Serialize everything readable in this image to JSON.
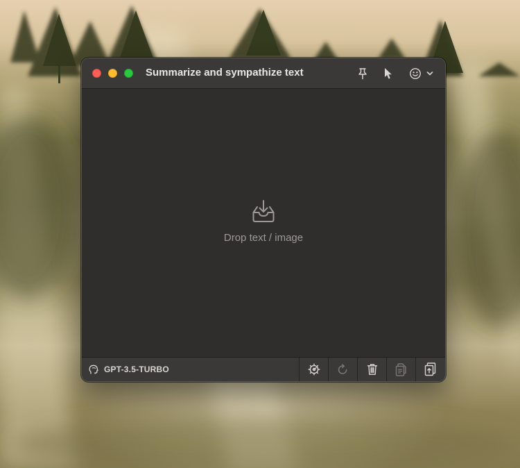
{
  "window": {
    "title": "Summarize and sympathize text"
  },
  "titlebar_icons": [
    "pin-icon",
    "cursor-icon",
    "smiley-icon",
    "chevron-down-icon"
  ],
  "content": {
    "drop_icon": "tray-download-icon",
    "drop_label": "Drop text / image"
  },
  "footer": {
    "model_icon": "head-icon",
    "model_label": "GPT-3.5-TURBO",
    "buttons": [
      "settings-gear-icon",
      "refresh-icon",
      "trash-icon",
      "copy-icon",
      "share-icon"
    ]
  },
  "colors": {
    "window_bg": "#2f2e2c",
    "titlebar_bg": "#3a3937",
    "close": "#ff5f57",
    "minimize": "#febc2e",
    "maximize": "#28c840",
    "muted_text": "#9d9a96"
  }
}
